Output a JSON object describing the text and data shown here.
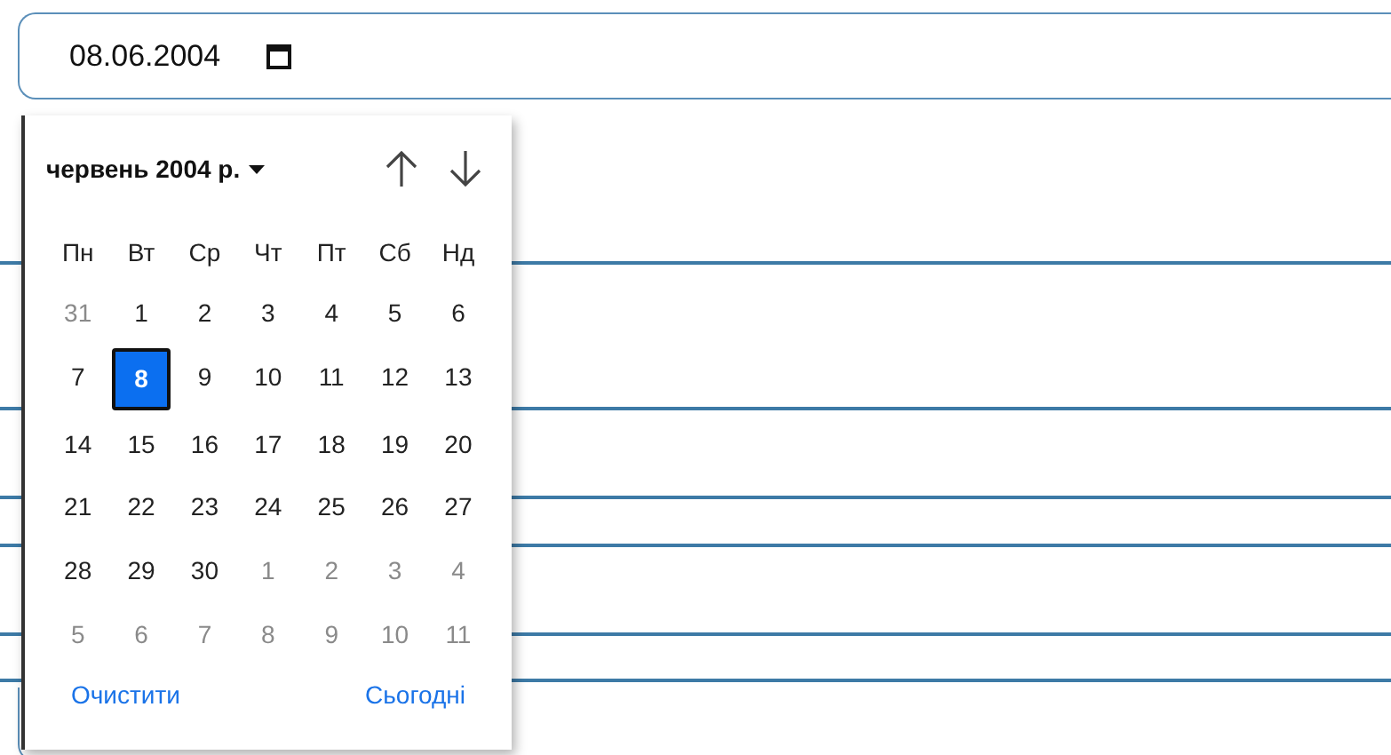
{
  "date_field": {
    "value": "08.06.2004"
  },
  "picker": {
    "month_label": "червень 2004 р.",
    "weekdays": [
      "Пн",
      "Вт",
      "Ср",
      "Чт",
      "Пт",
      "Сб",
      "Нд"
    ],
    "weeks": [
      [
        {
          "day": "31",
          "outside": true,
          "selected": false
        },
        {
          "day": "1",
          "outside": false,
          "selected": false
        },
        {
          "day": "2",
          "outside": false,
          "selected": false
        },
        {
          "day": "3",
          "outside": false,
          "selected": false
        },
        {
          "day": "4",
          "outside": false,
          "selected": false
        },
        {
          "day": "5",
          "outside": false,
          "selected": false
        },
        {
          "day": "6",
          "outside": false,
          "selected": false
        }
      ],
      [
        {
          "day": "7",
          "outside": false,
          "selected": false
        },
        {
          "day": "8",
          "outside": false,
          "selected": true
        },
        {
          "day": "9",
          "outside": false,
          "selected": false
        },
        {
          "day": "10",
          "outside": false,
          "selected": false
        },
        {
          "day": "11",
          "outside": false,
          "selected": false
        },
        {
          "day": "12",
          "outside": false,
          "selected": false
        },
        {
          "day": "13",
          "outside": false,
          "selected": false
        }
      ],
      [
        {
          "day": "14",
          "outside": false,
          "selected": false
        },
        {
          "day": "15",
          "outside": false,
          "selected": false
        },
        {
          "day": "16",
          "outside": false,
          "selected": false
        },
        {
          "day": "17",
          "outside": false,
          "selected": false
        },
        {
          "day": "18",
          "outside": false,
          "selected": false
        },
        {
          "day": "19",
          "outside": false,
          "selected": false
        },
        {
          "day": "20",
          "outside": false,
          "selected": false
        }
      ],
      [
        {
          "day": "21",
          "outside": false,
          "selected": false
        },
        {
          "day": "22",
          "outside": false,
          "selected": false
        },
        {
          "day": "23",
          "outside": false,
          "selected": false
        },
        {
          "day": "24",
          "outside": false,
          "selected": false
        },
        {
          "day": "25",
          "outside": false,
          "selected": false
        },
        {
          "day": "26",
          "outside": false,
          "selected": false
        },
        {
          "day": "27",
          "outside": false,
          "selected": false
        }
      ],
      [
        {
          "day": "28",
          "outside": false,
          "selected": false
        },
        {
          "day": "29",
          "outside": false,
          "selected": false
        },
        {
          "day": "30",
          "outside": false,
          "selected": false
        },
        {
          "day": "1",
          "outside": true,
          "selected": false
        },
        {
          "day": "2",
          "outside": true,
          "selected": false
        },
        {
          "day": "3",
          "outside": true,
          "selected": false
        },
        {
          "day": "4",
          "outside": true,
          "selected": false
        }
      ],
      [
        {
          "day": "5",
          "outside": true,
          "selected": false
        },
        {
          "day": "6",
          "outside": true,
          "selected": false
        },
        {
          "day": "7",
          "outside": true,
          "selected": false
        },
        {
          "day": "8",
          "outside": true,
          "selected": false
        },
        {
          "day": "9",
          "outside": true,
          "selected": false
        },
        {
          "day": "10",
          "outside": true,
          "selected": false
        },
        {
          "day": "11",
          "outside": true,
          "selected": false
        }
      ]
    ],
    "footer_buttons": [
      "Очистити",
      "Сьогодні"
    ]
  }
}
